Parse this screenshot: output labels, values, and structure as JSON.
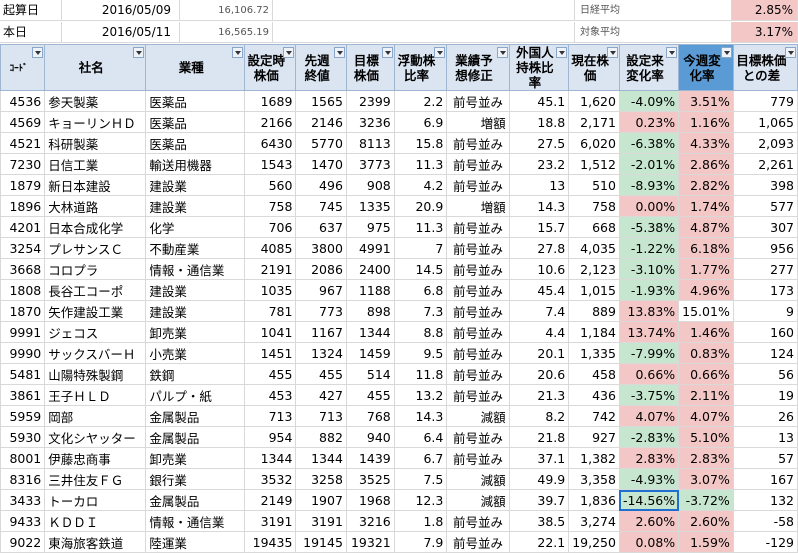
{
  "top": {
    "row1": {
      "label": "起算日",
      "date": "2016/05/09",
      "value": "16,106.72",
      "avg_label": "日経平均",
      "pct": "2.85%"
    },
    "row2": {
      "label": "本日",
      "date": "2016/05/11",
      "value": "16,565.19",
      "avg_label": "対象平均",
      "pct": "3.17%"
    }
  },
  "columns": [
    "ｺｰﾄﾞ",
    "社名",
    "業種",
    "設定時株価",
    "先週終値",
    "目標株価",
    "浮動株比率",
    "業績予想修正",
    "外国人持株比率",
    "現在株価",
    "設定来変化率",
    "今週変化率",
    "目標株価との差"
  ],
  "rows": [
    [
      "4536",
      "参天製薬",
      "医薬品",
      "1689",
      "1565",
      "2399",
      "2.2",
      "前号並み",
      "45.1",
      "1,620",
      "-4.09%",
      "3.51%",
      "779"
    ],
    [
      "4569",
      "キョーリンＨＤ",
      "医薬品",
      "2166",
      "2146",
      "3236",
      "6.9",
      "増額",
      "18.8",
      "2,171",
      "0.23%",
      "1.16%",
      "1,065"
    ],
    [
      "4521",
      "科研製薬",
      "医薬品",
      "6430",
      "5770",
      "8113",
      "15.8",
      "前号並み",
      "27.5",
      "6,020",
      "-6.38%",
      "4.33%",
      "2,093"
    ],
    [
      "7230",
      "日信工業",
      "輸送用機器",
      "1543",
      "1470",
      "3773",
      "11.3",
      "前号並み",
      "23.2",
      "1,512",
      "-2.01%",
      "2.86%",
      "2,261"
    ],
    [
      "1879",
      "新日本建設",
      "建設業",
      "560",
      "496",
      "908",
      "4.2",
      "前号並み",
      "13",
      "510",
      "-8.93%",
      "2.82%",
      "398"
    ],
    [
      "1896",
      "大林道路",
      "建設業",
      "758",
      "745",
      "1335",
      "20.9",
      "増額",
      "14.3",
      "758",
      "0.00%",
      "1.74%",
      "577"
    ],
    [
      "4201",
      "日本合成化学",
      "化学",
      "706",
      "637",
      "975",
      "11.3",
      "前号並み",
      "15.7",
      "668",
      "-5.38%",
      "4.87%",
      "307"
    ],
    [
      "3254",
      "プレサンスＣ",
      "不動産業",
      "4085",
      "3800",
      "4991",
      "7",
      "前号並み",
      "27.8",
      "4,035",
      "-1.22%",
      "6.18%",
      "956"
    ],
    [
      "3668",
      "コロプラ",
      "情報・通信業",
      "2191",
      "2086",
      "2400",
      "14.5",
      "前号並み",
      "10.6",
      "2,123",
      "-3.10%",
      "1.77%",
      "277"
    ],
    [
      "1808",
      "長谷工コーポ",
      "建設業",
      "1035",
      "967",
      "1188",
      "6.8",
      "前号並み",
      "45.4",
      "1,015",
      "-1.93%",
      "4.96%",
      "173"
    ],
    [
      "1870",
      "矢作建設工業",
      "建設業",
      "781",
      "773",
      "898",
      "7.3",
      "前号並み",
      "7.4",
      "889",
      "13.83%",
      "15.01%",
      "9"
    ],
    [
      "9991",
      "ジェコス",
      "卸売業",
      "1041",
      "1167",
      "1344",
      "8.8",
      "前号並み",
      "4.4",
      "1,184",
      "13.74%",
      "1.46%",
      "160"
    ],
    [
      "9990",
      "サックスバーＨ",
      "小売業",
      "1451",
      "1324",
      "1459",
      "9.5",
      "前号並み",
      "20.1",
      "1,335",
      "-7.99%",
      "0.83%",
      "124"
    ],
    [
      "5481",
      "山陽特殊製鋼",
      "鉄鋼",
      "455",
      "455",
      "514",
      "11.8",
      "前号並み",
      "20.6",
      "458",
      "0.66%",
      "0.66%",
      "56"
    ],
    [
      "3861",
      "王子ＨＬＤ",
      "パルプ・紙",
      "453",
      "427",
      "455",
      "13.2",
      "前号並み",
      "21.3",
      "436",
      "-3.75%",
      "2.11%",
      "19"
    ],
    [
      "5959",
      "岡部",
      "金属製品",
      "713",
      "713",
      "768",
      "14.3",
      "減額",
      "8.2",
      "742",
      "4.07%",
      "4.07%",
      "26"
    ],
    [
      "5930",
      "文化シヤッター",
      "金属製品",
      "954",
      "882",
      "940",
      "6.4",
      "前号並み",
      "21.8",
      "927",
      "-2.83%",
      "5.10%",
      "13"
    ],
    [
      "8001",
      "伊藤忠商事",
      "卸売業",
      "1344",
      "1344",
      "1439",
      "6.7",
      "前号並み",
      "37.1",
      "1,382",
      "2.83%",
      "2.83%",
      "57"
    ],
    [
      "8316",
      "三井住友ＦＧ",
      "銀行業",
      "3532",
      "3258",
      "3525",
      "7.5",
      "減額",
      "49.9",
      "3,358",
      "-4.93%",
      "3.07%",
      "167"
    ],
    [
      "3433",
      "トーカロ",
      "金属製品",
      "2149",
      "1907",
      "1968",
      "12.3",
      "減額",
      "39.7",
      "1,836",
      "-14.56%",
      "-3.72%",
      "132"
    ],
    [
      "9433",
      "ＫＤＤＩ",
      "情報・通信業",
      "3191",
      "3191",
      "3216",
      "1.8",
      "前号並み",
      "38.5",
      "3,274",
      "2.60%",
      "2.60%",
      "-58"
    ],
    [
      "9022",
      "東海旅客鉄道",
      "陸運業",
      "19435",
      "19145",
      "19321",
      "7.9",
      "前号並み",
      "22.1",
      "19,250",
      "0.08%",
      "1.59%",
      "-129"
    ]
  ],
  "colors": {
    "red": "#f4c7c7",
    "green": "#c6e6cf",
    "header_blue": "#5b9bd5",
    "header_light": "#dbe5f1",
    "selection": "#1f6fd1"
  }
}
